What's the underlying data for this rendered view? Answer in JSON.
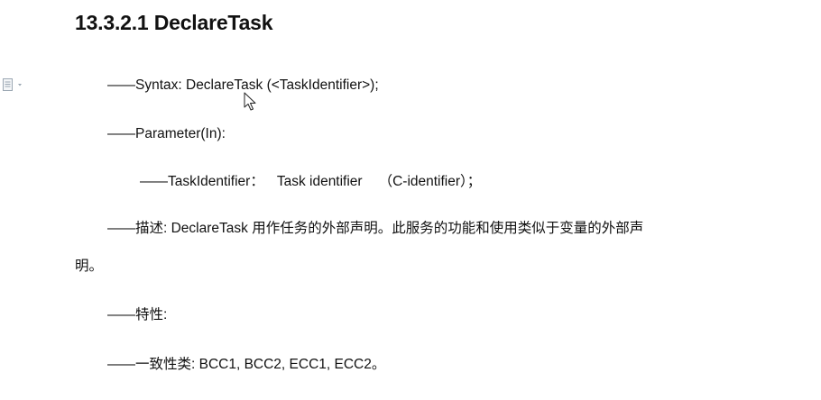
{
  "section": {
    "heading": "13.3.2.1 DeclareTask"
  },
  "content": {
    "syntax": "——Syntax: DeclareTask (<TaskIdentifier>);",
    "parameter": "——Parameter(In):",
    "task_identifier": {
      "label": "——TaskIdentifier：",
      "desc": "Task identifier",
      "type": "（C-identifier）；"
    },
    "description_line1": "——描述: DeclareTask 用作任务的外部声明。此服务的功能和使用类似于变量的外部声",
    "description_line2": "明。",
    "characteristics": "——特性:",
    "conformance": "——一致性类: BCC1, BCC2, ECC1, ECC2。"
  },
  "icons": {
    "margin_marker": "paragraph-options-icon",
    "pointer": "mouse-cursor-icon"
  }
}
